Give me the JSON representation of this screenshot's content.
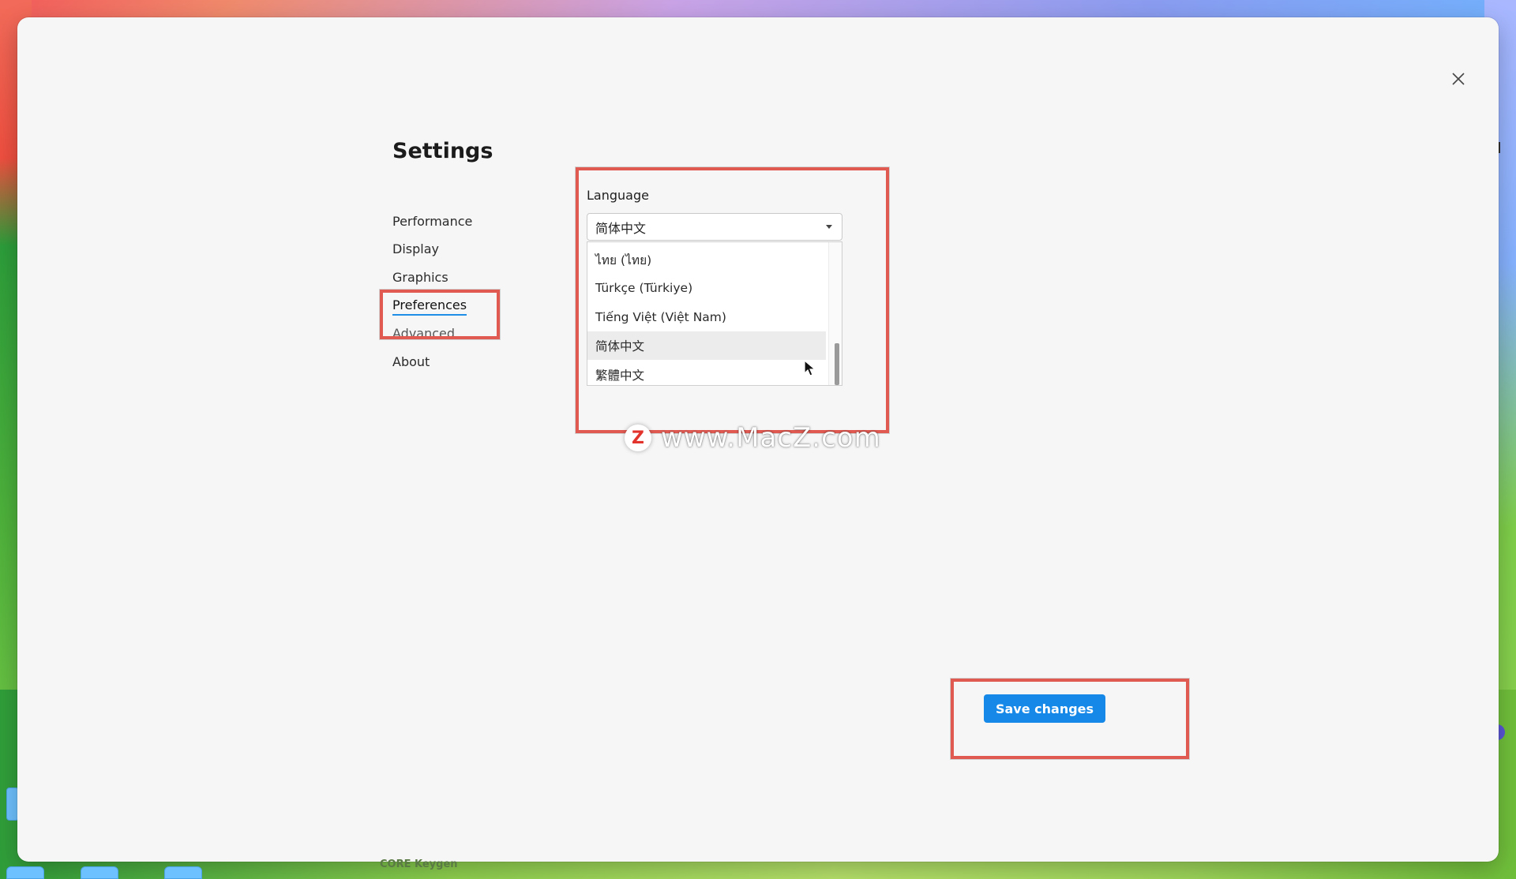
{
  "window": {
    "title": "Settings",
    "close_icon": "close-icon"
  },
  "sidebar": {
    "items": [
      {
        "label": "Performance"
      },
      {
        "label": "Display"
      },
      {
        "label": "Graphics"
      },
      {
        "label": "Preferences",
        "active": true
      },
      {
        "label": "Advanced"
      },
      {
        "label": "About"
      }
    ]
  },
  "language": {
    "label": "Language",
    "selected": "简体中文",
    "options": [
      {
        "label": "ไทย (ไทย)"
      },
      {
        "label": "Türkçe (Türkiye)"
      },
      {
        "label": "Tiếng Việt (Việt Nam)"
      },
      {
        "label": "简体中文",
        "hovered": true
      },
      {
        "label": "繁體中文"
      }
    ]
  },
  "actions": {
    "save_label": "Save changes"
  },
  "watermark": {
    "logo_letter": "Z",
    "text": "www.MacZ.com"
  },
  "dock": {
    "label": "CORE Keygen"
  },
  "colors": {
    "accent": "#1688e8",
    "highlight_box": "#e05a52",
    "active_underline": "#1f8ee6"
  }
}
